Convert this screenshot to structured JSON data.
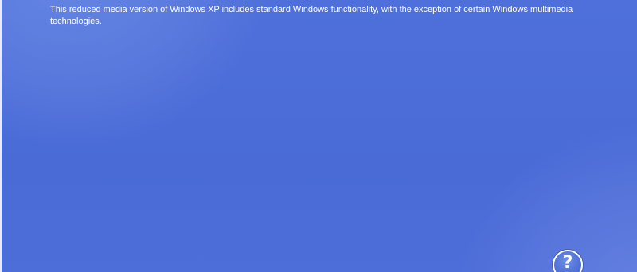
{
  "setup": {
    "description": "This reduced media version of Windows XP includes standard Windows functionality, with the exception of certain Windows multimedia technologies.",
    "help_glyph": "?"
  },
  "colors": {
    "background": "#4c6ed8",
    "text": "#ffffff"
  },
  "icons": {
    "help": "help-question-icon"
  }
}
